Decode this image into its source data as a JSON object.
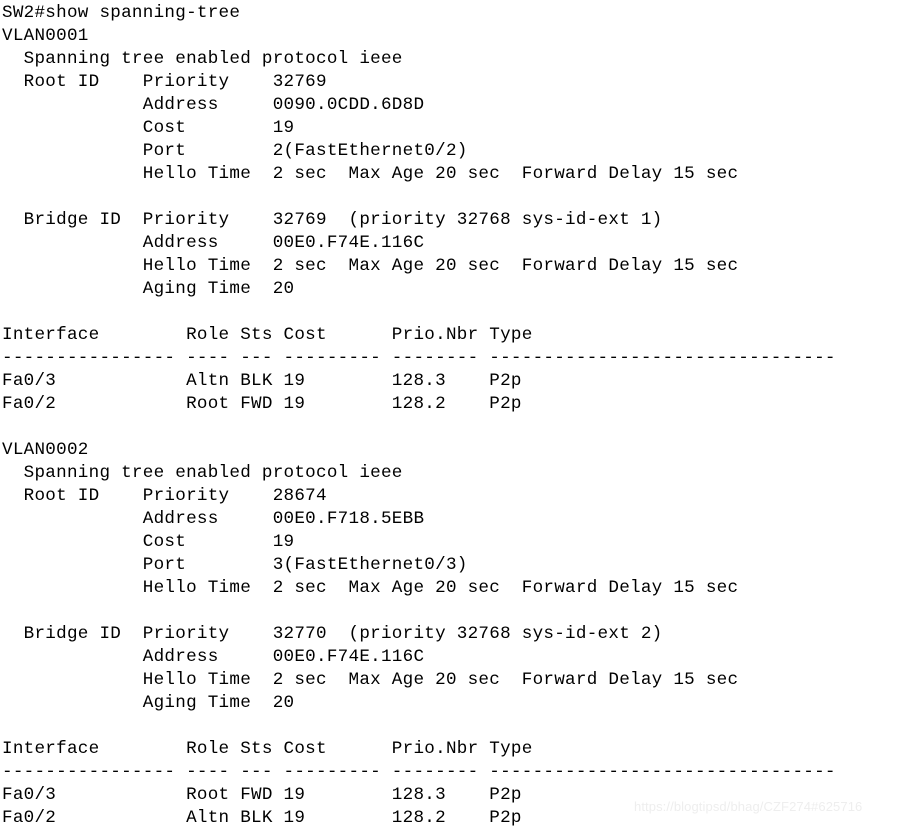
{
  "terminal": {
    "prompt": "SW2#",
    "command": "show spanning-tree",
    "command_line": "SW2#show spanning-tree",
    "background_color": "#ffffff",
    "text_color": "#000000",
    "lines": [
      "SW2#show spanning-tree",
      "VLAN0001",
      "  Spanning tree enabled protocol ieee",
      "  Root ID    Priority    32769",
      "             Address     0090.0CDD.6D8D",
      "             Cost        19",
      "             Port        2(FastEthernet0/2)",
      "             Hello Time  2 sec  Max Age 20 sec  Forward Delay 15 sec",
      "",
      "  Bridge ID  Priority    32769  (priority 32768 sys-id-ext 1)",
      "             Address     00E0.F74E.116C",
      "             Hello Time  2 sec  Max Age 20 sec  Forward Delay 15 sec",
      "             Aging Time  20",
      "",
      "Interface        Role Sts Cost      Prio.Nbr Type",
      "---------------- ---- --- --------- -------- --------------------------------",
      "Fa0/3            Altn BLK 19        128.3    P2p",
      "Fa0/2            Root FWD 19        128.2    P2p",
      "",
      "VLAN0002",
      "  Spanning tree enabled protocol ieee",
      "  Root ID    Priority    28674",
      "             Address     00E0.F718.5EBB",
      "             Cost        19",
      "             Port        3(FastEthernet0/3)",
      "             Hello Time  2 sec  Max Age 20 sec  Forward Delay 15 sec",
      "",
      "  Bridge ID  Priority    32770  (priority 32768 sys-id-ext 2)",
      "             Address     00E0.F74E.116C",
      "             Hello Time  2 sec  Max Age 20 sec  Forward Delay 15 sec",
      "             Aging Time  20",
      "",
      "Interface        Role Sts Cost      Prio.Nbr Type",
      "---------------- ---- --- --------- -------- --------------------------------",
      "Fa0/3            Root FWD 19        128.3    P2p",
      "Fa0/2            Altn BLK 19        128.2    P2p"
    ]
  },
  "vlans": [
    {
      "name": "VLAN0001",
      "protocol_line": "Spanning tree enabled protocol ieee",
      "protocol": "ieee",
      "root_id": {
        "label": "Root ID",
        "priority": "32769",
        "address": "0090.0CDD.6D8D",
        "cost": "19",
        "port": "2(FastEthernet0/2)",
        "hello_time": "2 sec",
        "max_age": "20 sec",
        "forward_delay": "15 sec"
      },
      "bridge_id": {
        "label": "Bridge ID",
        "priority": "32769",
        "priority_detail": "(priority 32768 sys-id-ext 1)",
        "address": "00E0.F74E.116C",
        "hello_time": "2 sec",
        "max_age": "20 sec",
        "forward_delay": "15 sec",
        "aging_time": "20"
      },
      "table": {
        "columns": [
          "Interface",
          "Role",
          "Sts",
          "Cost",
          "Prio.Nbr",
          "Type"
        ],
        "rows": [
          {
            "interface": "Fa0/3",
            "role": "Altn",
            "sts": "BLK",
            "cost": "19",
            "prio_nbr": "128.3",
            "type": "P2p"
          },
          {
            "interface": "Fa0/2",
            "role": "Root",
            "sts": "FWD",
            "cost": "19",
            "prio_nbr": "128.2",
            "type": "P2p"
          }
        ]
      }
    },
    {
      "name": "VLAN0002",
      "protocol_line": "Spanning tree enabled protocol ieee",
      "protocol": "ieee",
      "root_id": {
        "label": "Root ID",
        "priority": "28674",
        "address": "00E0.F718.5EBB",
        "cost": "19",
        "port": "3(FastEthernet0/3)",
        "hello_time": "2 sec",
        "max_age": "20 sec",
        "forward_delay": "15 sec"
      },
      "bridge_id": {
        "label": "Bridge ID",
        "priority": "32770",
        "priority_detail": "(priority 32768 sys-id-ext 2)",
        "address": "00E0.F74E.116C",
        "hello_time": "2 sec",
        "max_age": "20 sec",
        "forward_delay": "15 sec",
        "aging_time": "20"
      },
      "table": {
        "columns": [
          "Interface",
          "Role",
          "Sts",
          "Cost",
          "Prio.Nbr",
          "Type"
        ],
        "rows": [
          {
            "interface": "Fa0/3",
            "role": "Root",
            "sts": "FWD",
            "cost": "19",
            "prio_nbr": "128.3",
            "type": "P2p"
          },
          {
            "interface": "Fa0/2",
            "role": "Altn",
            "sts": "BLK",
            "cost": "19",
            "prio_nbr": "128.2",
            "type": "P2p"
          }
        ]
      }
    }
  ],
  "watermark": {
    "text": "https://blogtipsd/bhag/CZF274#625716",
    "color": "#eeeeee"
  }
}
